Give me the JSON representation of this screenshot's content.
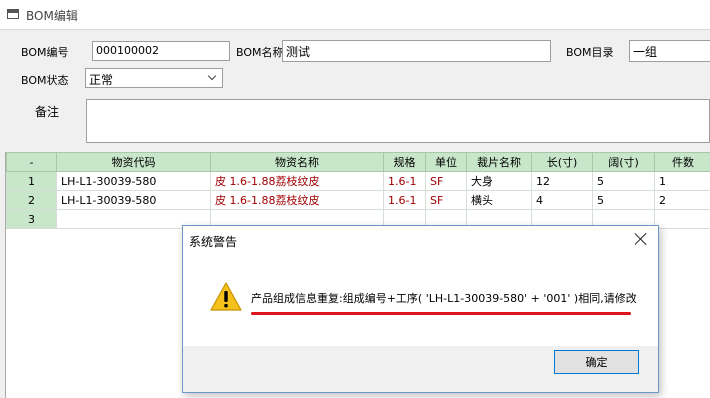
{
  "window": {
    "title": "BOM编辑"
  },
  "form": {
    "bom_no_label": "BOM编号",
    "bom_no_value": "000100002",
    "bom_name_label": "BOM名称",
    "bom_name_value": "测试",
    "bom_dir_label": "BOM目录",
    "bom_dir_value": "一组",
    "bom_status_label": "BOM状态",
    "bom_status_value": "正常",
    "remark_label": "备注",
    "remark_value": ""
  },
  "grid": {
    "headers": [
      "-",
      "物资代码",
      "物资名称",
      "规格",
      "单位",
      "裁片名称",
      "长(寸)",
      "阔(寸)",
      "件数"
    ],
    "rows": [
      {
        "num": "1",
        "code": "LH-L1-30039-580",
        "name": "皮  1.6-1.88荔枝纹皮",
        "spec": "1.6-1",
        "unit": "SF",
        "piece": "大身",
        "len": "12",
        "width": "5",
        "qty": "1"
      },
      {
        "num": "2",
        "code": "LH-L1-30039-580",
        "name": "皮  1.6-1.88荔枝纹皮",
        "spec": "1.6-1",
        "unit": "SF",
        "piece": "横头",
        "len": "4",
        "width": "5",
        "qty": "2"
      },
      {
        "num": "3",
        "code": "",
        "name": "",
        "spec": "",
        "unit": "",
        "piece": "",
        "len": "",
        "width": "",
        "qty": ""
      }
    ]
  },
  "dialog": {
    "title": "系统警告",
    "message": "产品组成信息重复:组成编号+工序( 'LH-L1-30039-580' + '001' )相同,请修改",
    "ok_label": "确定",
    "icon": "warning-icon",
    "underline_color": "#e0141e"
  }
}
